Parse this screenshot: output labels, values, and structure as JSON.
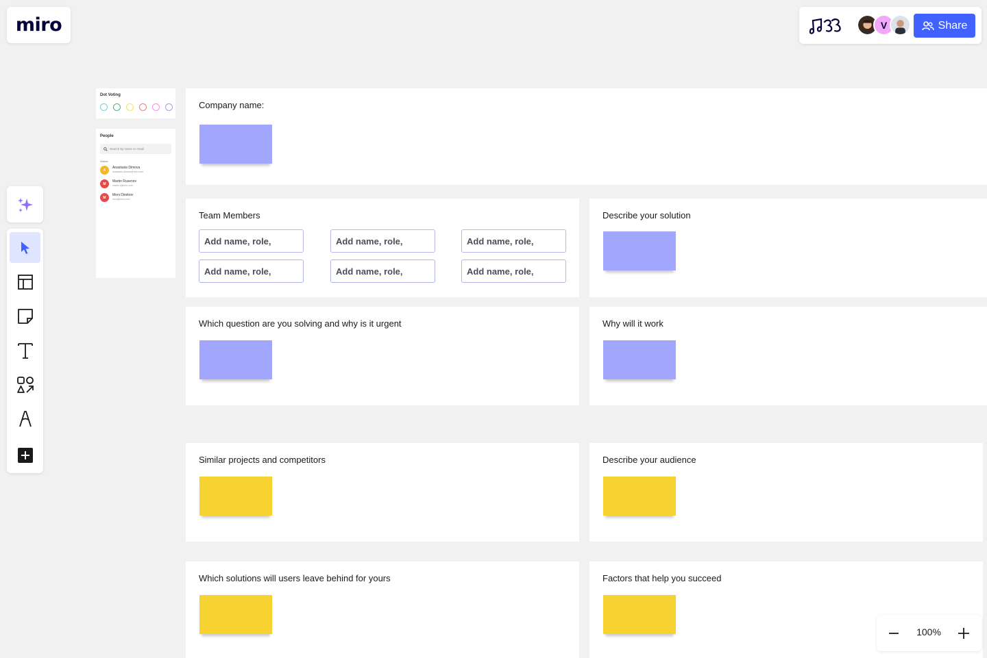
{
  "app": {
    "logo": "miro",
    "share_label": "Share",
    "avatars": [
      {
        "initial": "",
        "bg": "#8a4b2e",
        "name": "user-avatar-1"
      },
      {
        "initial": "V",
        "bg": "#f2a7f8",
        "name": "user-avatar-2"
      },
      {
        "initial": "",
        "bg": "#5b5b66",
        "name": "user-avatar-3"
      }
    ],
    "accent": "#4262ff"
  },
  "toolbar": {
    "tools": [
      "ai-sparkle",
      "select",
      "templates",
      "sticky-note",
      "text",
      "shapes",
      "pen",
      "add-more"
    ]
  },
  "zoom": {
    "level": "100%"
  },
  "sidebar": {
    "dot_voting": {
      "title": "Dot Voting",
      "dot_colors": [
        "#6fd3d9",
        "#3dbd74",
        "#f3e161",
        "#f07a7a",
        "#f192e6",
        "#a09af6"
      ]
    },
    "people": {
      "title": "People",
      "search_placeholder": "Search by name or email",
      "online_label": "Online",
      "list": [
        {
          "initial": "A",
          "color": "#f3b62c",
          "name": "Anastasia Dimova",
          "email": "anastasia.dimova@miro.com"
        },
        {
          "initial": "M",
          "color": "#e34b4b",
          "name": "Martin Rusenov",
          "email": "martin.r@miro.com"
        },
        {
          "initial": "M",
          "color": "#e34b4b",
          "name": "Moni Dimitrov",
          "email": "moni@miro.com"
        }
      ]
    }
  },
  "frames": {
    "company": {
      "title": "Company name:"
    },
    "team": {
      "title": "Team Members",
      "slots": [
        "Add name, role,",
        "Add name, role,",
        "Add name, role,",
        "Add name, role,",
        "Add name, role,",
        "Add name, role,"
      ]
    },
    "solution": {
      "title": "Describe your solution"
    },
    "question": {
      "title": "Which question are you solving and why is it urgent"
    },
    "why_work": {
      "title": "Why will it work"
    },
    "competitors": {
      "title": "Similar projects and competitors"
    },
    "audience": {
      "title": "Describe your audience"
    },
    "leave_behind": {
      "title": "Which solutions will users leave behind for yours"
    },
    "factors": {
      "title": "Factors that help you succeed"
    }
  },
  "colors": {
    "sticky_purple": "#a2a6fd",
    "sticky_yellow": "#f6d330"
  }
}
